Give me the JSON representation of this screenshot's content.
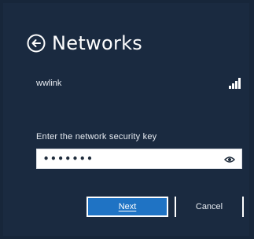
{
  "header": {
    "title": "Networks",
    "back_icon": "back-arrow-circle-icon"
  },
  "network": {
    "name": "wwlink",
    "signal_icon": "wifi-signal-icon"
  },
  "password": {
    "prompt": "Enter the network security key",
    "value": "•••••••",
    "reveal_icon": "eye-icon"
  },
  "buttons": {
    "next_label": "Next",
    "cancel_label": "Cancel"
  },
  "colors": {
    "background": "#1a2a40",
    "accent": "#1f73c4",
    "text": "#ffffff"
  }
}
